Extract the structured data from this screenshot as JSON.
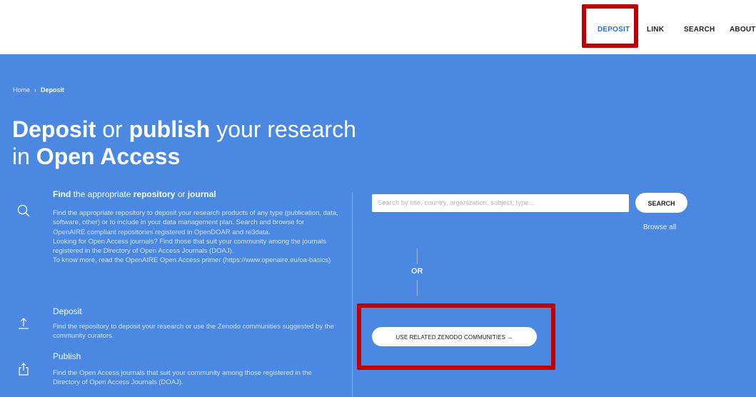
{
  "nav": {
    "deposit": "DEPOSIT",
    "link": "LINK",
    "search": "SEARCH",
    "about": "ABOUT"
  },
  "breadcrumb": {
    "home": "Home",
    "separator": "›",
    "current": "Deposit"
  },
  "title": {
    "w1": "Deposit",
    "w2": " or ",
    "w3": "publish",
    "w4": " your research",
    "w5": "in ",
    "w6": "Open Access"
  },
  "find": {
    "heading_bold1": "Find",
    "heading_mid1": " the appropriate ",
    "heading_bold2": "repository",
    "heading_mid2": " or ",
    "heading_bold3": "journal",
    "body1": "Find the appropriate repository to deposit your research products of any type (publication, data, software, other) or to include in your data management plan. Search and browse for OpenAIRE compliant repositories registered in OpenDOAR and re3data.",
    "body2": "Looking for Open Access journals? Find those that suit your community among the journals registered in the Directory of Open Access Journals (DOAJ).",
    "body3": "To know more, read the OpenAIRE Open Access primer (https://www.openaire.eu/oa-basics)"
  },
  "deposit": {
    "heading": "Deposit",
    "body": "Find the repository to deposit your research or use the Zenodo communities suggested by the community curators."
  },
  "publish": {
    "heading": "Publish",
    "body": "Find the Open Access journals that suit your community among those registered in the Directory of Open Access Journals (DOAJ)."
  },
  "search": {
    "placeholder": "Search by title, country, organization, subject, type...",
    "button": "SEARCH",
    "browse_all": "Browse all"
  },
  "or_label": "OR",
  "zenodo_button": "USE RELATED ZENODO COMMUNITIES →",
  "colors": {
    "hero_bg": "#4a88e2",
    "accent": "#2c6fd6",
    "highlight": "#c00000"
  },
  "icons": {
    "find": "search-icon",
    "deposit": "upload-icon",
    "publish": "share-icon"
  }
}
